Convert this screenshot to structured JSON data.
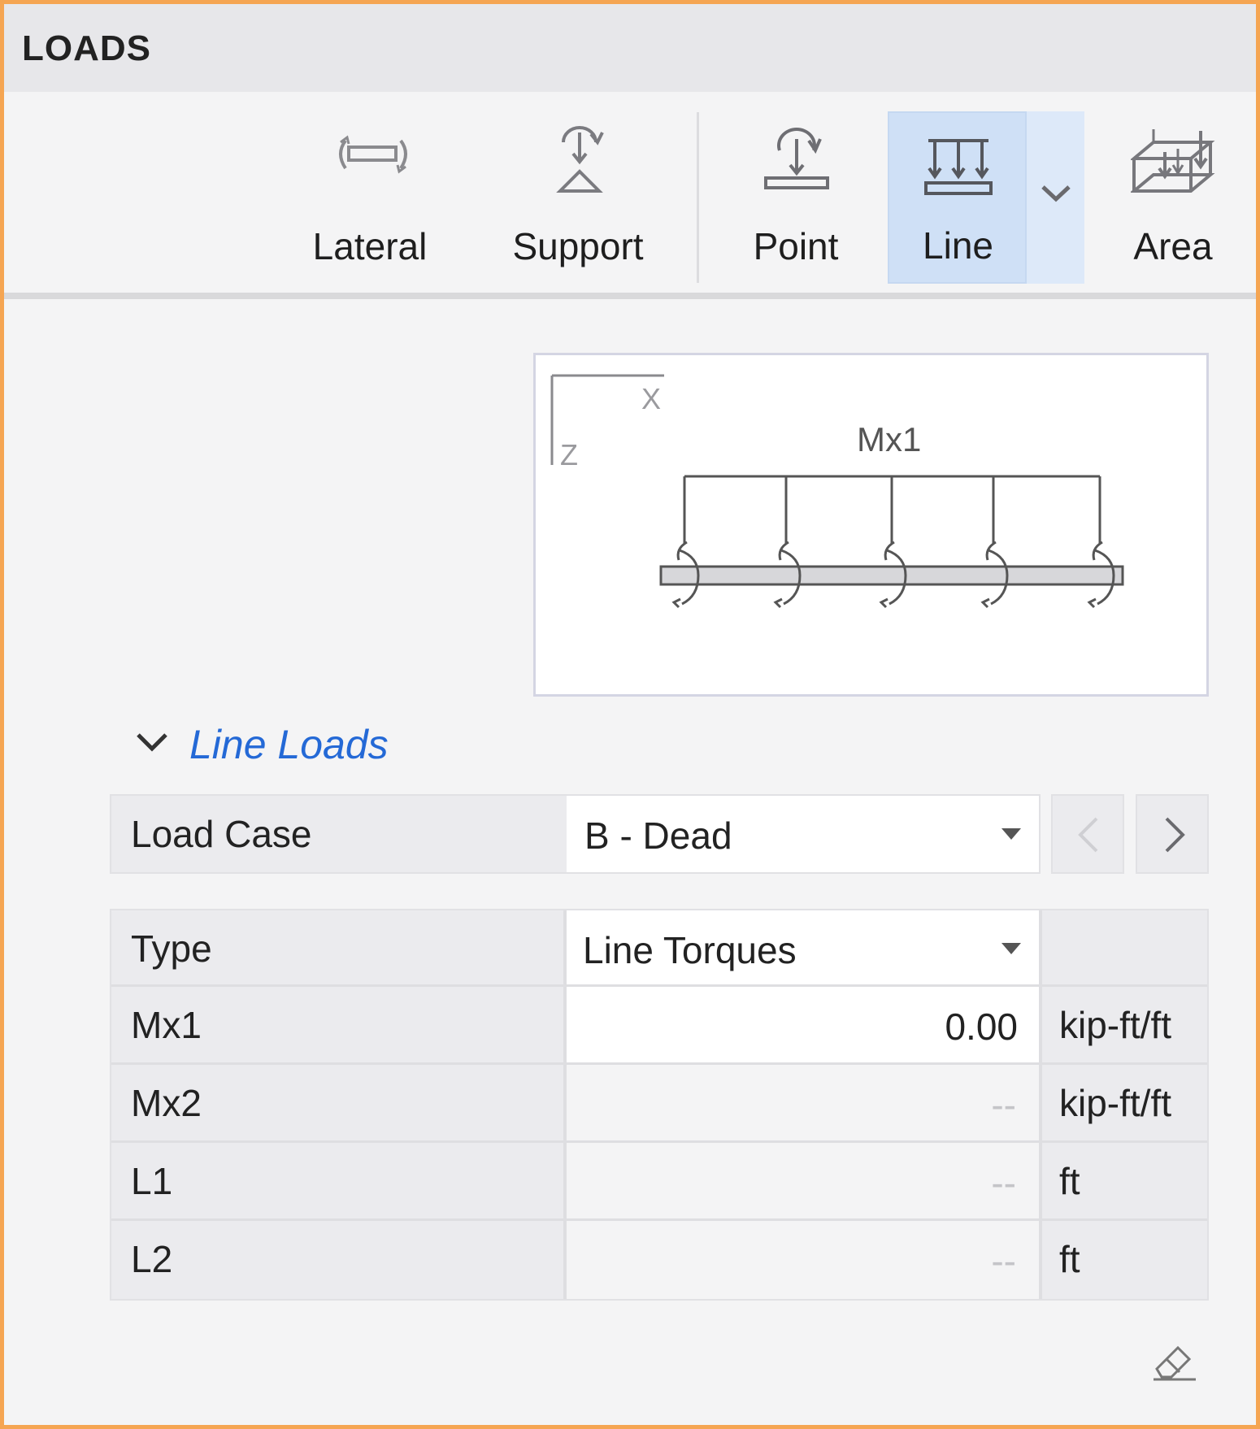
{
  "panel": {
    "title": "LOADS"
  },
  "ribbon": {
    "buttons": [
      {
        "label": "Lateral",
        "icon": "lateral-load-icon"
      },
      {
        "label": "Support",
        "icon": "support-load-icon"
      },
      {
        "label": "Point",
        "icon": "point-load-icon"
      },
      {
        "label": "Line",
        "icon": "line-load-icon",
        "selected": true
      },
      {
        "label": "Area",
        "icon": "area-load-icon"
      }
    ],
    "selected_color": "#cfe0f6"
  },
  "preview": {
    "axis_x": "X",
    "axis_z": "Z",
    "load_label": "Mx1"
  },
  "section": {
    "title": "Line Loads",
    "expanded": true,
    "title_color": "#2469d6"
  },
  "load_case": {
    "label": "Load Case",
    "value": "B - Dead"
  },
  "properties": {
    "type": {
      "label": "Type",
      "value": "Line Torques"
    },
    "rows": [
      {
        "label": "Mx1",
        "value": "0.00",
        "unit": "kip-ft/ft",
        "editable": true
      },
      {
        "label": "Mx2",
        "value": "--",
        "unit": "kip-ft/ft",
        "editable": false
      },
      {
        "label": "L1",
        "value": "--",
        "unit": "ft",
        "editable": false
      },
      {
        "label": "L2",
        "value": "--",
        "unit": "ft",
        "editable": false
      }
    ]
  },
  "accent_border": "#f5a552"
}
